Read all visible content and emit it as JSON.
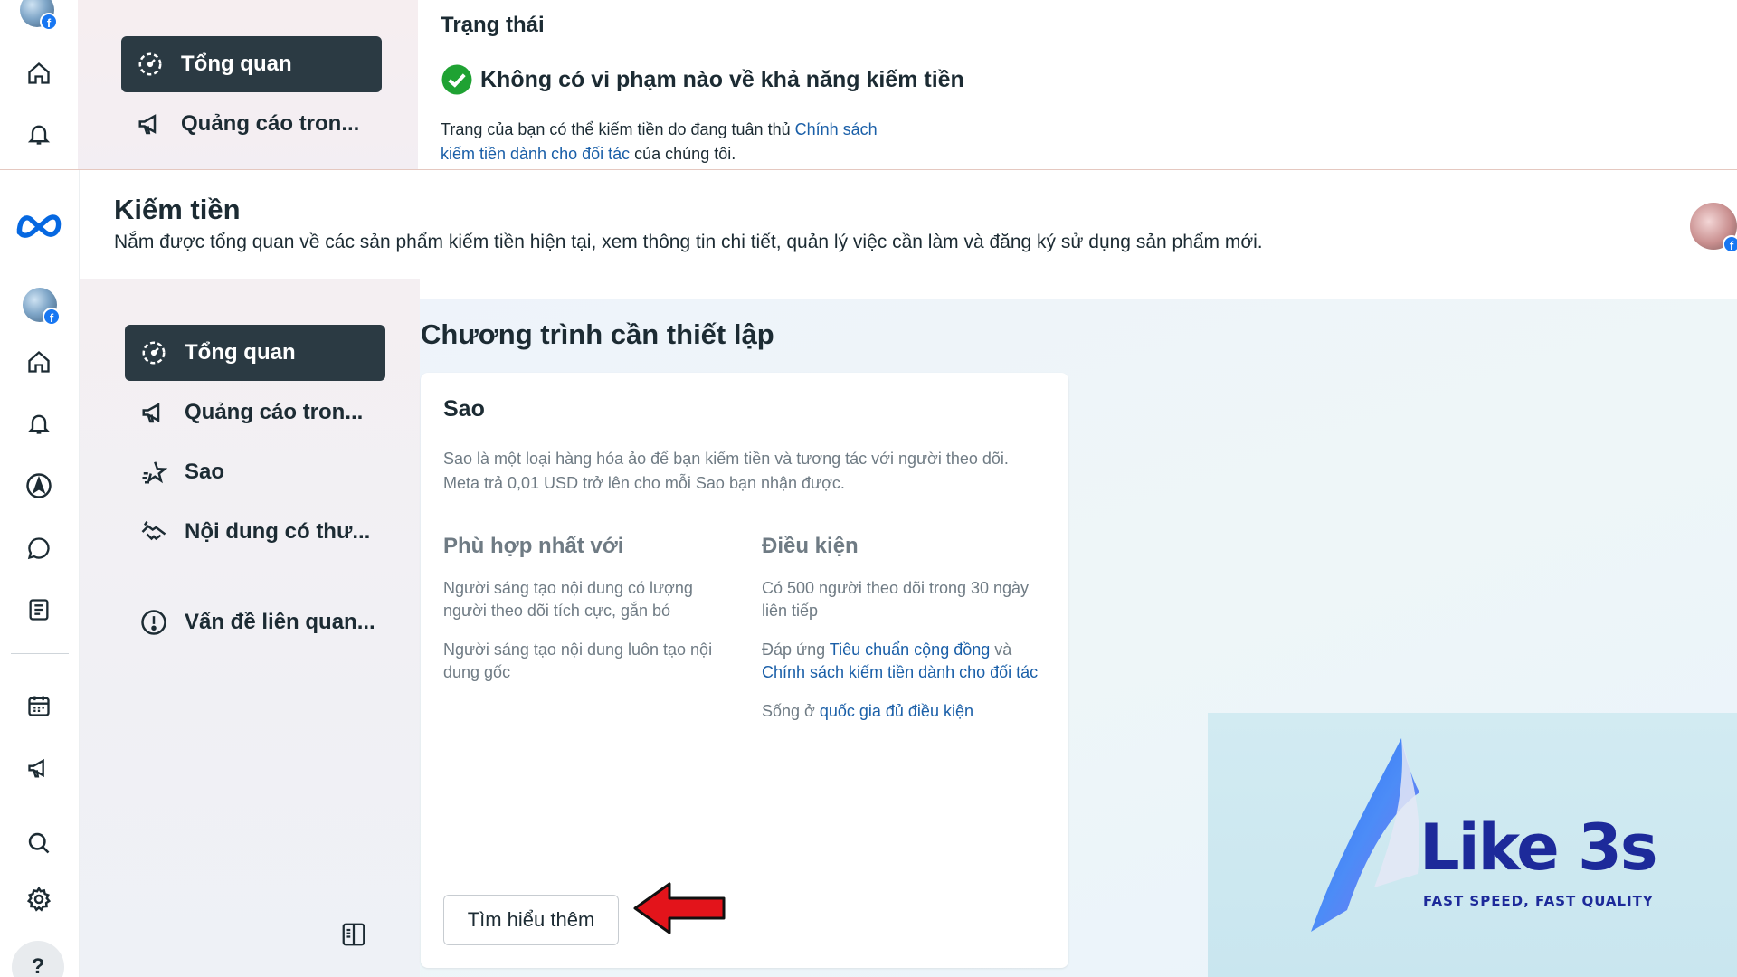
{
  "top": {
    "nav": {
      "overview_label": "Tổng quan",
      "ads_label": "Quảng cáo tron..."
    },
    "status": {
      "title": "Trạng thái",
      "headline": "Không có vi phạm nào về khả năng kiếm tiền",
      "body_prefix": "Trang của bạn có thể kiếm tiền do đang tuân thủ ",
      "body_link": "Chính sách kiếm tiền dành cho đối tác",
      "body_suffix": " của chúng tôi.",
      "check_color": "#1fa233"
    }
  },
  "header": {
    "title": "Kiếm tiền",
    "subtitle": "Nắm được tổng quan về các sản phẩm kiếm tiền hiện tại, xem thông tin chi tiết, quản lý việc cần làm và đăng ký sử dụng sản phẩm mới."
  },
  "rail": {
    "icons": [
      "meta-logo-icon",
      "profile-avatar",
      "home-icon",
      "bell-icon",
      "compass-icon",
      "chat-icon",
      "pages-icon",
      "calendar-icon",
      "megaphone-icon",
      "search-icon",
      "gear-icon",
      "help-icon"
    ],
    "help_label": "?"
  },
  "nav": {
    "items": [
      {
        "label": "Tổng quan",
        "icon": "gauge-icon",
        "active": true
      },
      {
        "label": "Quảng cáo tron...",
        "icon": "megaphone-icon",
        "active": false
      },
      {
        "label": "Sao",
        "icon": "star-icon",
        "active": false
      },
      {
        "label": "Nội dung có thư...",
        "icon": "handshake-icon",
        "active": false
      },
      {
        "label": "Vấn đề liên quan...",
        "icon": "alert-circle-icon",
        "active": false
      }
    ],
    "collapse_icon": "panel-toggle-icon"
  },
  "main": {
    "section_title": "Chương trình cần thiết lập",
    "card": {
      "title": "Sao",
      "description_line1": "Sao là một loại hàng hóa ảo để bạn kiếm tiền và tương tác với người theo dõi.",
      "description_line2": "Meta trả 0,01 USD trở lên cho mỗi Sao bạn nhận được.",
      "best_for": {
        "heading": "Phù hợp nhất với",
        "items": [
          "Người sáng tạo nội dung có lượng người theo dõi tích cực, gắn bó",
          "Người sáng tạo nội dung luôn tạo nội dung gốc"
        ]
      },
      "requirements": {
        "heading": "Điều kiện",
        "item1": "Có 500 người theo dõi trong 30 ngày liên tiếp",
        "item2_prefix": "Đáp ứng ",
        "item2_link1": "Tiêu chuẩn cộng đồng",
        "item2_mid": " và ",
        "item2_link2": "Chính sách kiếm tiền dành cho đối tác",
        "item3_prefix": "Sống ở ",
        "item3_link": "quốc gia đủ điều kiện"
      },
      "button_label": "Tìm hiểu thêm"
    }
  },
  "watermark": {
    "brand": "Like 3s",
    "tagline": "FAST SPEED, FAST QUALITY"
  },
  "colors": {
    "accent_dark": "#2b3a43",
    "link": "#1a5fa8",
    "meta_blue": "#0668e1",
    "arrow_red": "#e3141b"
  }
}
